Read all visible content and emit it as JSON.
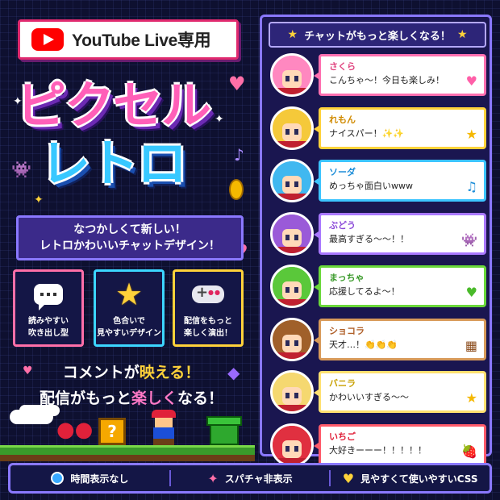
{
  "badge": {
    "text": "YouTube Live専用"
  },
  "title": {
    "line1": "ピクセル",
    "line2": "レトロ"
  },
  "tagline": {
    "line1": "なつかしくて新しい！",
    "line2": "レトロかわいいチャットデザイン！"
  },
  "features": [
    {
      "label": "読みやすい\n吹き出し型",
      "icon": "speech-bubble-icon"
    },
    {
      "label": "色合いで\n見やすいデザイン",
      "icon": "star-icon"
    },
    {
      "label": "配信をもっと\n楽しく演出！",
      "icon": "gamepad-icon"
    }
  ],
  "headline": {
    "l1a": "コメントが",
    "l1b": "映える！",
    "l2a": "配信がもっと",
    "l2b": "楽しく",
    "l2c": "なる！"
  },
  "chat": {
    "header": "チャットがもっと楽しくなる！",
    "messages": [
      {
        "name": "さくら",
        "text": "こんちゃ〜！今日も楽しみ！",
        "icon": "♥",
        "name_color": "#e0447f",
        "border": "#ff6fb0",
        "hair": "#ff88c0",
        "icon_color": "#ff5fa8"
      },
      {
        "name": "れもん",
        "text": "ナイスパー！✨✨",
        "icon": "★",
        "name_color": "#d08a00",
        "border": "#ffd23a",
        "hair": "#f5c93a",
        "icon_color": "#f5b800"
      },
      {
        "name": "ソーダ",
        "text": "めっちゃ面白いwww",
        "icon": "♫",
        "name_color": "#1e8ed8",
        "border": "#3cc4ff",
        "hair": "#40b8f0",
        "icon_color": "#1e8ed8"
      },
      {
        "name": "ぶどう",
        "text": "最高すぎる〜〜！！",
        "icon": "👾",
        "name_color": "#8a48d8",
        "border": "#a978ff",
        "hair": "#9a5ad8",
        "icon_color": "#7a3ad0"
      },
      {
        "name": "まっちゃ",
        "text": "応援してるよ〜！",
        "icon": "♥",
        "name_color": "#3a9a2a",
        "border": "#6ad83a",
        "hair": "#5ac83a",
        "icon_color": "#4aba2a"
      },
      {
        "name": "ショコラ",
        "text": "天才…！👏👏👏",
        "icon": "▦",
        "name_color": "#b0602a",
        "border": "#d89a5a",
        "hair": "#a0602a",
        "icon_color": "#8a4a1a"
      },
      {
        "name": "バニラ",
        "text": "かわいいすぎる〜〜",
        "icon": "★",
        "name_color": "#c8a000",
        "border": "#ffe070",
        "hair": "#f5d870",
        "icon_color": "#f5b800"
      },
      {
        "name": "いちご",
        "text": "大好きーーー！！！！！",
        "icon": "🍓",
        "name_color": "#e0213a",
        "border": "#ff5a6a",
        "hair": "#e03040",
        "icon_color": "#e0213a"
      }
    ]
  },
  "footer": [
    {
      "label": "時間表示なし",
      "icon": "clock-icon"
    },
    {
      "label": "スパチャ非表示",
      "icon": "diamond-icon"
    },
    {
      "label": "見やすくて使いやすいCSS",
      "icon": "heart-icon"
    }
  ],
  "scene": {
    "qblock": "?"
  }
}
